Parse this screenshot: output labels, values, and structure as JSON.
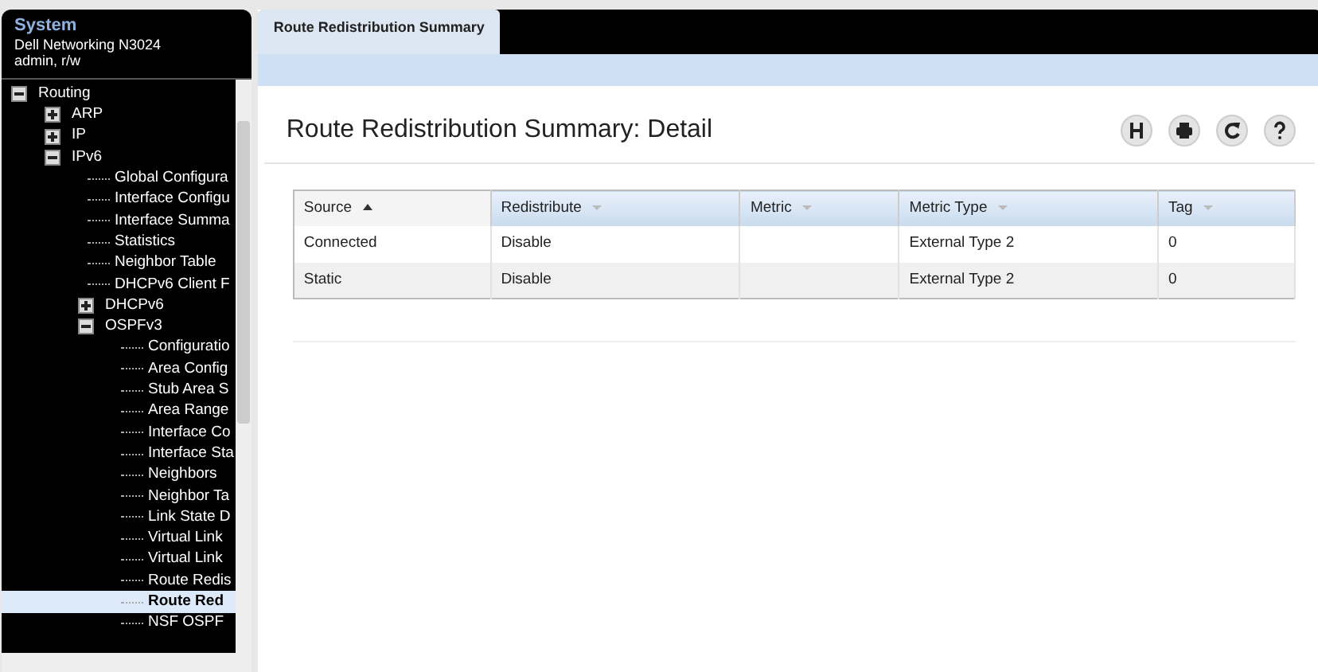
{
  "sidebar": {
    "title": "System",
    "device": "Dell Networking N3024",
    "user": "admin, r/w",
    "tree": [
      {
        "label": "Routing",
        "expanded": true,
        "selected": false,
        "children": [
          {
            "label": "ARP",
            "expanded": false,
            "selected": false
          },
          {
            "label": "IP",
            "expanded": false,
            "selected": false
          },
          {
            "label": "IPv6",
            "expanded": true,
            "selected": false,
            "children": [
              {
                "label": "Global Configura",
                "selected": false
              },
              {
                "label": "Interface Configu",
                "selected": false
              },
              {
                "label": "Interface Summa",
                "selected": false
              },
              {
                "label": "Statistics",
                "selected": false
              },
              {
                "label": "Neighbor Table",
                "selected": false
              },
              {
                "label": "DHCPv6 Client F",
                "selected": false
              },
              {
                "label": "DHCPv6",
                "expanded": false,
                "selected": false
              },
              {
                "label": "OSPFv3",
                "expanded": true,
                "selected": false,
                "children": [
                  {
                    "label": "Configuratio",
                    "selected": false
                  },
                  {
                    "label": "Area Config",
                    "selected": false
                  },
                  {
                    "label": "Stub Area S",
                    "selected": false
                  },
                  {
                    "label": "Area Range",
                    "selected": false
                  },
                  {
                    "label": "Interface Co",
                    "selected": false
                  },
                  {
                    "label": "Interface Sta",
                    "selected": false
                  },
                  {
                    "label": "Neighbors",
                    "selected": false
                  },
                  {
                    "label": "Neighbor Ta",
                    "selected": false
                  },
                  {
                    "label": "Link State D",
                    "selected": false
                  },
                  {
                    "label": "Virtual Link",
                    "selected": false
                  },
                  {
                    "label": "Virtual Link",
                    "selected": false
                  },
                  {
                    "label": "Route Redis",
                    "selected": false
                  },
                  {
                    "label": "Route Red",
                    "selected": true
                  },
                  {
                    "label": "NSF OSPF",
                    "selected": false
                  }
                ]
              }
            ]
          }
        ]
      }
    ]
  },
  "tabs": [
    {
      "label": "Route Redistribution Summary",
      "selected": true
    }
  ],
  "page_title": "Route Redistribution Summary: Detail",
  "table": {
    "columns": [
      {
        "label": "Source",
        "sorted": true
      },
      {
        "label": "Redistribute",
        "sorted": false
      },
      {
        "label": "Metric",
        "sorted": false
      },
      {
        "label": "Metric Type",
        "sorted": false
      },
      {
        "label": "Tag",
        "sorted": false
      }
    ],
    "rows": [
      [
        "Connected",
        "Disable",
        "",
        "External Type 2",
        "0"
      ],
      [
        "Static",
        "Disable",
        "",
        "External Type 2",
        "0"
      ]
    ]
  }
}
